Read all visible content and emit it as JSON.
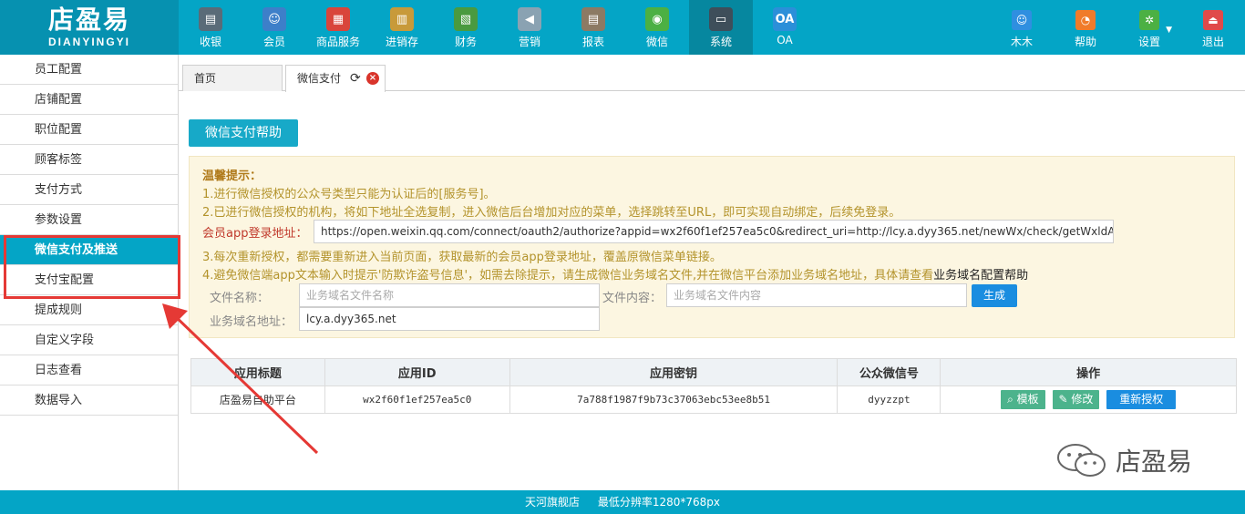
{
  "brand": {
    "name_cn": "店盈易",
    "name_en": "DIANYINGYI"
  },
  "nav": [
    {
      "label": "收银",
      "icon": "cash-register-icon",
      "color": "#5a6b78",
      "glyph": "▤"
    },
    {
      "label": "会员",
      "icon": "member-icon",
      "color": "#3d7fc9",
      "glyph": "☺"
    },
    {
      "label": "商品服务",
      "icon": "goods-service-icon",
      "color": "#d9453b",
      "glyph": "▦"
    },
    {
      "label": "进销存",
      "icon": "inventory-icon",
      "color": "#c89a3a",
      "glyph": "▥"
    },
    {
      "label": "财务",
      "icon": "finance-icon",
      "color": "#4a9a3f",
      "glyph": "▧"
    },
    {
      "label": "营销",
      "icon": "marketing-icon",
      "color": "#8aa2b2",
      "glyph": "◀"
    },
    {
      "label": "报表",
      "icon": "report-icon",
      "color": "#8c7a64",
      "glyph": "▤"
    },
    {
      "label": "微信",
      "icon": "wechat-icon",
      "color": "#4cb043",
      "glyph": "◉"
    },
    {
      "label": "系统",
      "icon": "system-monitor-icon",
      "color": "#3e4e5a",
      "glyph": "▭",
      "active": true
    },
    {
      "label": "OA",
      "icon": "oa-icon",
      "color": "#2b8fd9",
      "glyph": "OA"
    }
  ],
  "nav_right": [
    {
      "label": "木木",
      "icon": "user-avatar-icon",
      "color": "#2f8fe0",
      "glyph": "☺"
    },
    {
      "label": "帮助",
      "icon": "help-bell-icon",
      "color": "#f07b2a",
      "glyph": "◔"
    },
    {
      "label": "设置",
      "icon": "settings-gear-icon",
      "color": "#4cb043",
      "glyph": "✲"
    },
    {
      "label": "退出",
      "icon": "logout-icon",
      "color": "#e04a4a",
      "glyph": "⏏"
    }
  ],
  "sidebar": [
    "员工配置",
    "店铺配置",
    "职位配置",
    "顾客标签",
    "支付方式",
    "参数设置",
    "微信支付及推送",
    "支付宝配置",
    "提成规则",
    "自定义字段",
    "日志查看",
    "数据导入"
  ],
  "sidebar_active_index": 6,
  "tabs": {
    "home": "首页",
    "current": "微信支付"
  },
  "help_button": "微信支付帮助",
  "tips": {
    "title": "温馨提示：",
    "line1": "1.进行微信授权的公众号类型只能为认证后的[服务号]。",
    "line2": "2.已进行微信授权的机构，将如下地址全选复制，进入微信后台增加对应的菜单，选择跳转至URL，即可实现自动绑定，后续免登录。",
    "url_label": "会员app登录地址：",
    "url_value": "https://open.weixin.qq.com/connect/oauth2/authorize?appid=wx2f60f1ef257ea5c0&redirect_uri=http://lcy.a.dyy365.net/newWx/check/getWxldAutoJum",
    "line3": "3.每次重新授权，都需要重新进入当前页面，获取最新的会员app登录地址，覆盖原微信菜单链接。",
    "line4": "4.避免微信端app文本输入时提示'防欺诈盗号信息'，如需去除提示，请生成微信业务域名文件,并在微信平台添加业务域名地址，具体请查看",
    "line4_link": "业务域名配置帮助"
  },
  "form": {
    "file_name_label": "文件名称：",
    "file_name_placeholder": "业务域名文件名称",
    "file_content_label": "文件内容：",
    "file_content_placeholder": "业务域名文件内容",
    "generate_button": "生成",
    "domain_label": "业务域名地址：",
    "domain_value": "lcy.a.dyy365.net"
  },
  "table": {
    "headers": [
      "应用标题",
      "应用ID",
      "应用密钥",
      "公众微信号",
      "操作"
    ],
    "rows": [
      {
        "title": "店盈易自助平台",
        "app_id": "wx2f60f1ef257ea5c0",
        "secret": "7a788f1987f9b73c37063ebc53ee8b51",
        "account": "dyyzzpt"
      }
    ],
    "actions": {
      "template": "模板",
      "edit": "修改",
      "reauth": "重新授权"
    }
  },
  "watermark": "店盈易",
  "footer": {
    "store": "天河旗舰店",
    "resolution": "最低分辨率1280*768px"
  }
}
